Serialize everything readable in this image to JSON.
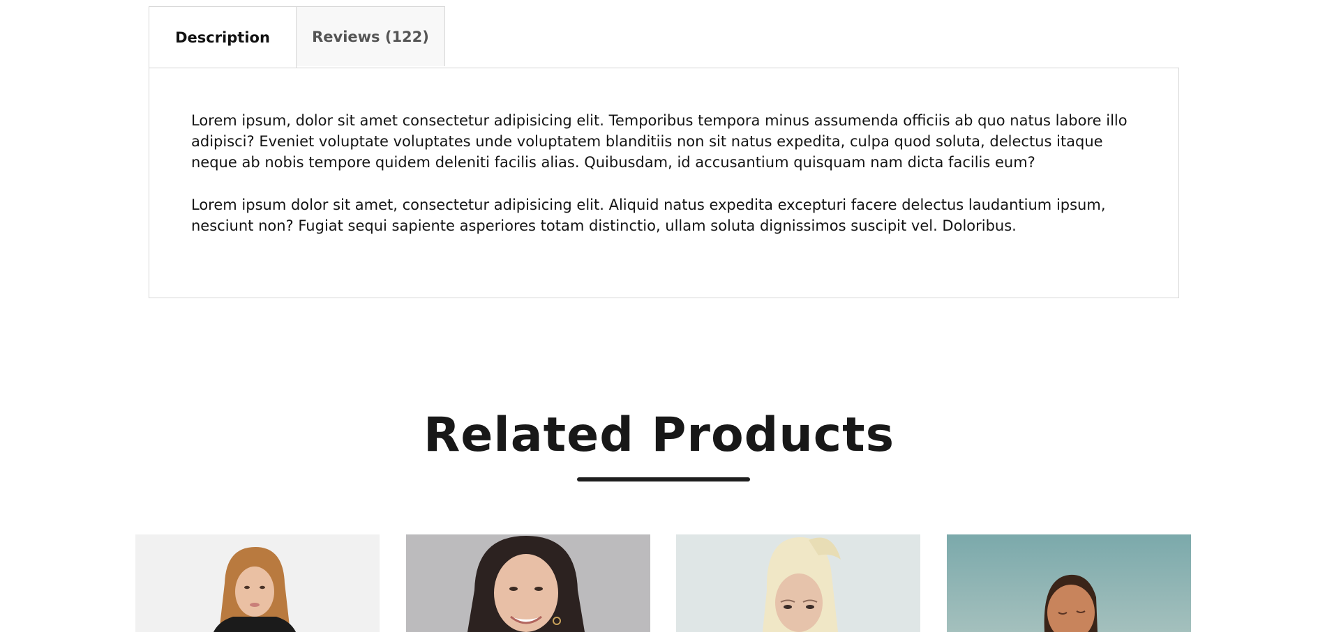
{
  "tabs": [
    {
      "label": "Description",
      "active": true
    },
    {
      "label": "Reviews (122)",
      "active": false
    }
  ],
  "description": {
    "paragraphs": [
      "Lorem ipsum, dolor sit amet consectetur adipisicing elit. Temporibus tempora minus assumenda officiis ab quo natus labore illo adipisci? Eveniet voluptate voluptates unde voluptatem blanditiis non sit natus expedita, culpa quod soluta, delectus itaque neque ab nobis tempore quidem deleniti facilis alias. Quibusdam, id accusantium quisquam nam dicta facilis eum?",
      "Lorem ipsum dolor sit amet, consectetur adipisicing elit. Aliquid natus expedita excepturi facere delectus laudantium ipsum, nesciunt non? Fugiat sequi sapiente asperiores totam distinctio, ullam soluta dignissimos suscipit vel. Doloribus."
    ]
  },
  "related": {
    "title": "Related Products",
    "products": [
      {
        "image": "woman-brown-hair-portrait",
        "background": "#f1f1f1"
      },
      {
        "image": "woman-dark-hair-smiling-portrait",
        "background": "#bcbbbd"
      },
      {
        "image": "woman-blonde-hair-portrait",
        "background": "#dfe6e6"
      },
      {
        "image": "woman-teal-background-portrait",
        "background": "#7ba9ab"
      }
    ]
  },
  "colors": {
    "border": "#d6d6d6",
    "text": "#111111",
    "inactive_tab_bg": "#f8f8f8",
    "inactive_tab_text": "#555555",
    "underline": "#1e1e1e"
  }
}
